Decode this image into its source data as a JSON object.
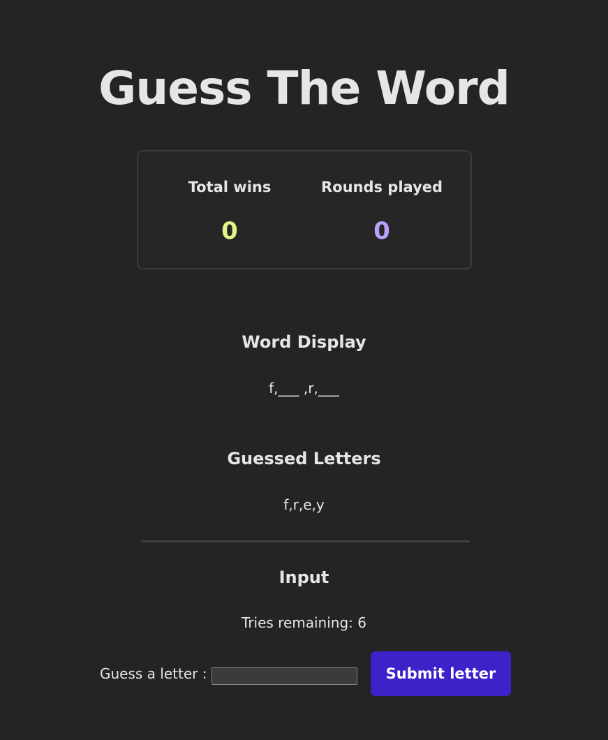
{
  "header": {
    "title": "Guess The Word"
  },
  "stats": {
    "wins_label": "Total wins",
    "wins_value": "0",
    "wins_color": "#e4f48b",
    "rounds_label": "Rounds played",
    "rounds_value": "0",
    "rounds_color": "#b9a1fb"
  },
  "word_display": {
    "title": "Word Display",
    "value": "f,___ ,r,___"
  },
  "guessed_letters": {
    "title": "Guessed Letters",
    "value": "f,r,e,y"
  },
  "input_section": {
    "title": "Input",
    "tries_text": "Tries remaining: 6",
    "guess_label": "Guess a letter :",
    "guess_value": "",
    "submit_label": "Submit letter",
    "submit_color": "#3c22c9"
  }
}
